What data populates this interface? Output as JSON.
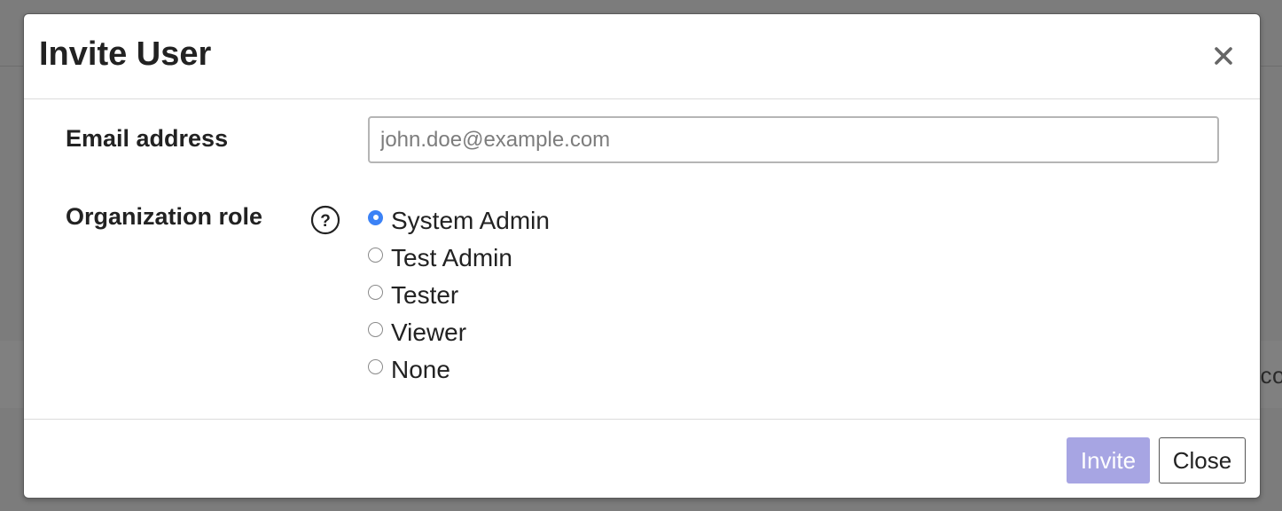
{
  "backdrop": {
    "partial_text": "co"
  },
  "modal": {
    "title": "Invite User",
    "close_icon": "close-icon"
  },
  "form": {
    "email": {
      "label": "Email address",
      "placeholder": "john.doe@example.com",
      "value": ""
    },
    "role": {
      "label": "Organization role",
      "help_icon": "question-circle-icon",
      "selected": "System Admin",
      "options": [
        "System Admin",
        "Test Admin",
        "Tester",
        "Viewer",
        "None"
      ]
    }
  },
  "footer": {
    "invite_label": "Invite",
    "close_label": "Close"
  },
  "colors": {
    "overlay": "#7c7c7c",
    "radio_checked": "#3b82f6",
    "invite_button": "#a7a5e3"
  }
}
